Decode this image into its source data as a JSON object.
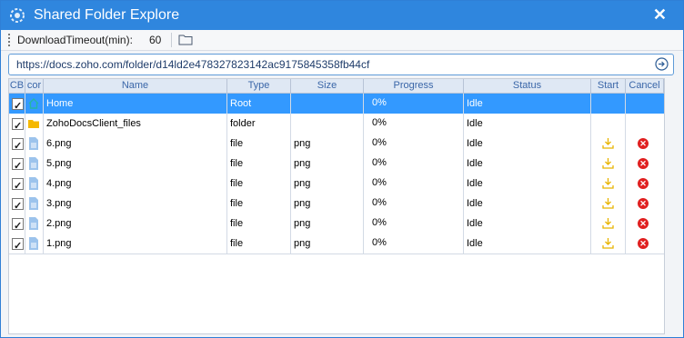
{
  "window": {
    "title": "Shared Folder Explore",
    "close_symbol": "✕"
  },
  "toolbar": {
    "timeout_label": "DownloadTimeout(min):",
    "timeout_value": "60"
  },
  "urlbar": {
    "url": "https://docs.zoho.com/folder/d14ld2e478327823142ac9175845358fb44cf"
  },
  "table": {
    "columns": [
      "CB",
      "cor",
      "Name",
      "Type",
      "Size",
      "Progress",
      "Status",
      "Start",
      "Cancel"
    ],
    "rows": [
      {
        "checked": true,
        "icon": "home-icon",
        "name": "Home",
        "type": "Root",
        "size": "",
        "progress": "0%",
        "status": "Idle",
        "start": false,
        "cancel": false,
        "selected": true
      },
      {
        "checked": true,
        "icon": "folder-icon",
        "name": "ZohoDocsClient_files",
        "type": "folder",
        "size": "",
        "progress": "0%",
        "status": "Idle",
        "start": false,
        "cancel": false,
        "selected": false
      },
      {
        "checked": true,
        "icon": "file-icon",
        "name": "6.png",
        "type": "file",
        "size": "png",
        "progress": "0%",
        "status": "Idle",
        "start": true,
        "cancel": true,
        "selected": false
      },
      {
        "checked": true,
        "icon": "file-icon",
        "name": "5.png",
        "type": "file",
        "size": "png",
        "progress": "0%",
        "status": "Idle",
        "start": true,
        "cancel": true,
        "selected": false
      },
      {
        "checked": true,
        "icon": "file-icon",
        "name": "4.png",
        "type": "file",
        "size": "png",
        "progress": "0%",
        "status": "Idle",
        "start": true,
        "cancel": true,
        "selected": false
      },
      {
        "checked": true,
        "icon": "file-icon",
        "name": "3.png",
        "type": "file",
        "size": "png",
        "progress": "0%",
        "status": "Idle",
        "start": true,
        "cancel": true,
        "selected": false
      },
      {
        "checked": true,
        "icon": "file-icon",
        "name": "2.png",
        "type": "file",
        "size": "png",
        "progress": "0%",
        "status": "Idle",
        "start": true,
        "cancel": true,
        "selected": false
      },
      {
        "checked": true,
        "icon": "file-icon",
        "name": "1.png",
        "type": "file",
        "size": "png",
        "progress": "0%",
        "status": "Idle",
        "start": true,
        "cancel": true,
        "selected": false
      }
    ]
  },
  "colors": {
    "titlebar": "#2f86de",
    "selection": "#3399ff",
    "header_text": "#3a66a8",
    "cancel": "#e02020",
    "download": "#e8b400",
    "folder": "#f5b800"
  }
}
